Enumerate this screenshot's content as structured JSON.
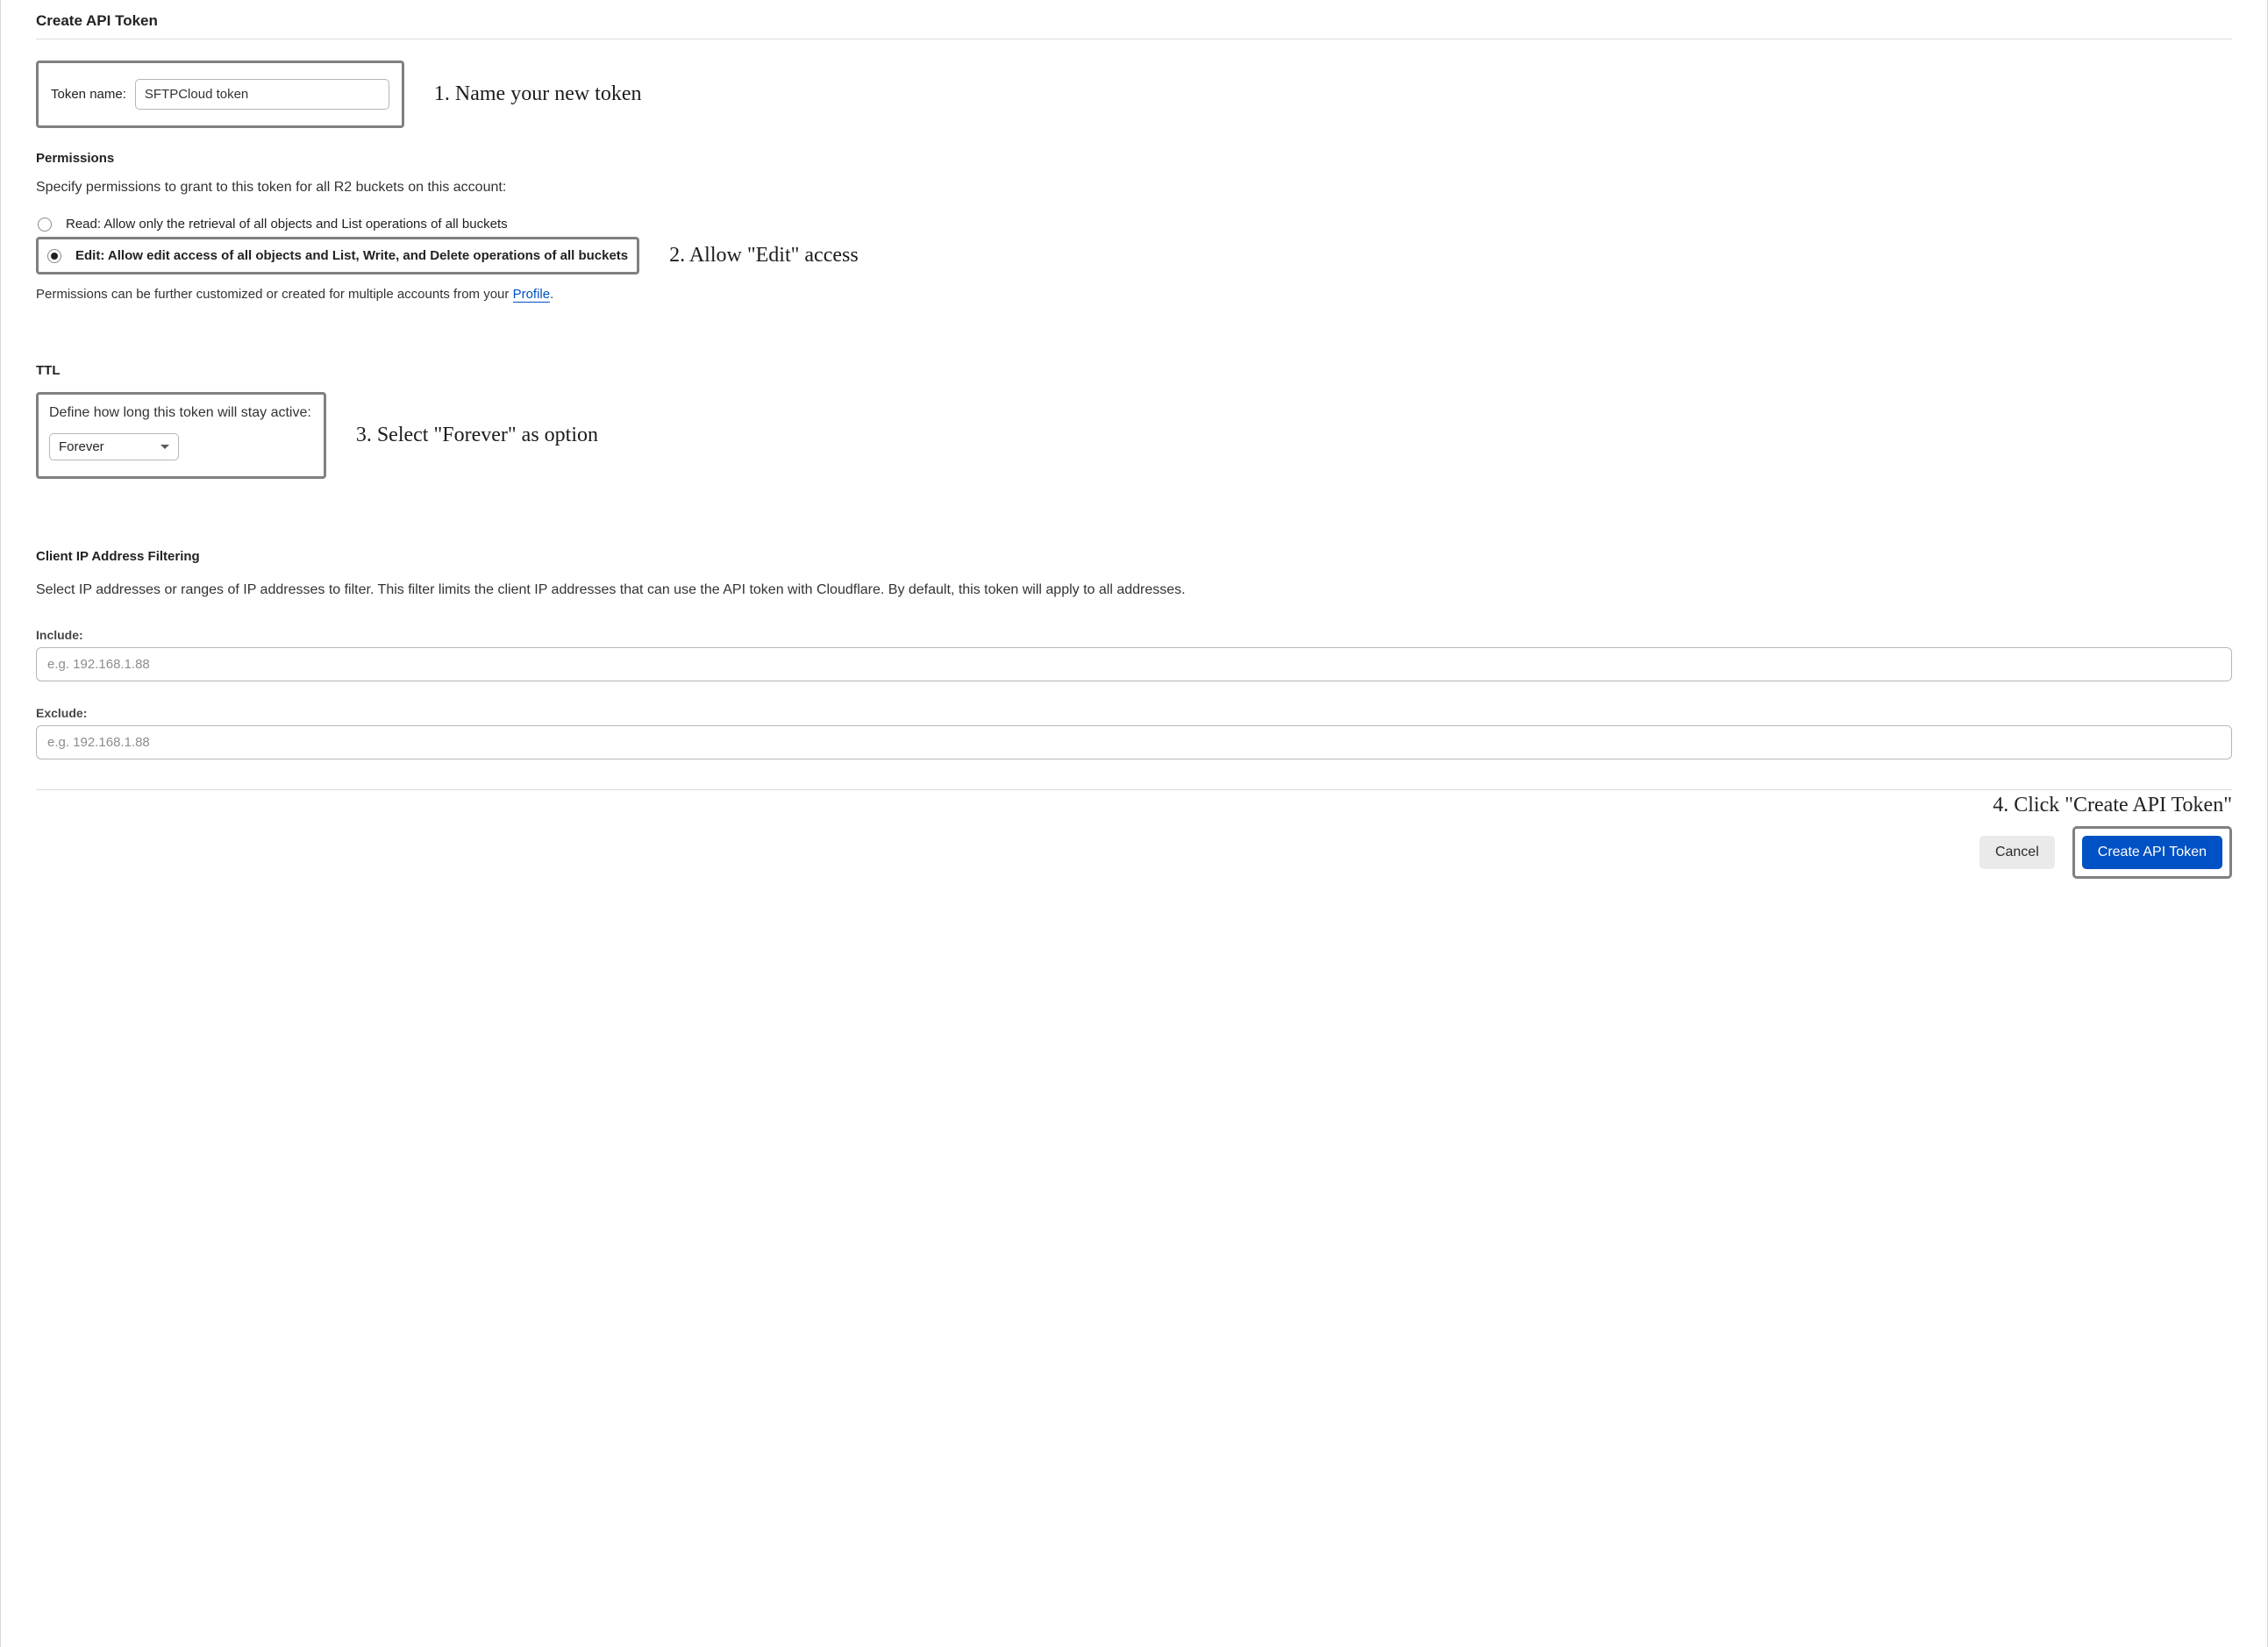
{
  "page": {
    "title": "Create API Token"
  },
  "tokenName": {
    "label": "Token name:",
    "value": "SFTPCloud token"
  },
  "annotations": {
    "step1": "1. Name your new token",
    "step2": "2. Allow \"Edit\" access",
    "step3": "3. Select \"Forever\" as option",
    "step4": "4. Click \"Create API Token\""
  },
  "permissions": {
    "heading": "Permissions",
    "description": "Specify permissions to grant to this token for all R2 buckets on this account:",
    "options": {
      "read": "Read: Allow only the retrieval of all objects and List operations of all buckets",
      "edit": "Edit: Allow edit access of all objects and List, Write, and Delete operations of all buckets"
    },
    "footnotePrefix": "Permissions can be further customized or created for multiple accounts from your ",
    "profileLink": "Profile",
    "footnoteSuffix": "."
  },
  "ttl": {
    "heading": "TTL",
    "description": "Define how long this token will stay active:",
    "selected": "Forever"
  },
  "ipFiltering": {
    "heading": "Client IP Address Filtering",
    "description": "Select IP addresses or ranges of IP addresses to filter. This filter limits the client IP addresses that can use the API token with Cloudflare. By default, this token will apply to all addresses.",
    "includeLabel": "Include:",
    "excludeLabel": "Exclude:",
    "placeholder": "e.g. 192.168.1.88"
  },
  "buttons": {
    "cancel": "Cancel",
    "create": "Create API Token"
  }
}
